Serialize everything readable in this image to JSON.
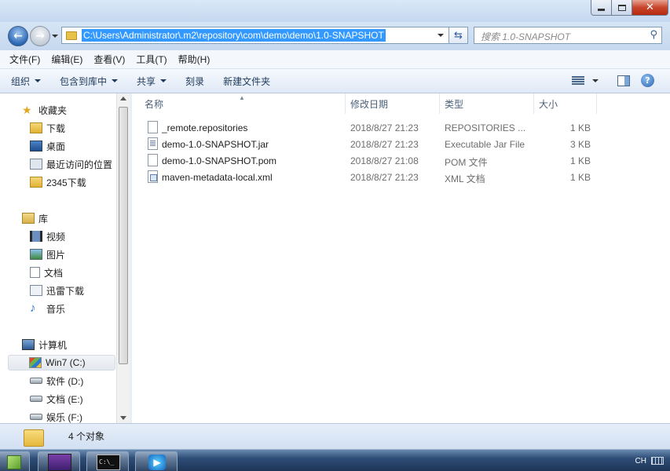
{
  "window": {
    "controls": {
      "minimize_icon": "minimize-icon",
      "maximize_icon": "maximize-icon",
      "close_icon": "close-icon"
    }
  },
  "address_bar": {
    "path": "C:\\Users\\Administrator\\.m2\\repository\\com\\demo\\demo\\1.0-SNAPSHOT",
    "refresh_icon": "refresh-icon"
  },
  "search": {
    "placeholder": "搜索 1.0-SNAPSHOT"
  },
  "menu": [
    "文件(F)",
    "编辑(E)",
    "查看(V)",
    "工具(T)",
    "帮助(H)"
  ],
  "toolbar": {
    "organize": "组织",
    "include_in_library": "包含到库中",
    "share": "共享",
    "burn": "刻录",
    "new_folder": "新建文件夹"
  },
  "nav": {
    "favorites": "收藏夹",
    "fav_items": [
      "下载",
      "桌面",
      "最近访问的位置",
      "2345下载"
    ],
    "libraries": "库",
    "lib_items": [
      "视频",
      "图片",
      "文档",
      "迅雷下载",
      "音乐"
    ],
    "computer": "计算机",
    "drives": [
      "Win7 (C:)",
      "软件 (D:)",
      "文档 (E:)",
      "娱乐 (F:)"
    ]
  },
  "columns": {
    "name": "名称",
    "modified": "修改日期",
    "type": "类型",
    "size": "大小"
  },
  "files": [
    {
      "name": "_remote.repositories",
      "modified": "2018/8/27 21:23",
      "type": "REPOSITORIES ...",
      "size": "1 KB",
      "icon": "file-icon"
    },
    {
      "name": "demo-1.0-SNAPSHOT.jar",
      "modified": "2018/8/27 21:23",
      "type": "Executable Jar File",
      "size": "3 KB",
      "icon": "jar-file-icon"
    },
    {
      "name": "demo-1.0-SNAPSHOT.pom",
      "modified": "2018/8/27 21:08",
      "type": "POM 文件",
      "size": "1 KB",
      "icon": "file-icon"
    },
    {
      "name": "maven-metadata-local.xml",
      "modified": "2018/8/27 21:23",
      "type": "XML 文档",
      "size": "1 KB",
      "icon": "xml-file-icon"
    }
  ],
  "status": {
    "count": "4 个对象"
  },
  "taskbar": {
    "apps": [
      "notepad-plus-plus-icon",
      "eclipse-java-ee-icon",
      "command-prompt-icon",
      "media-player-icon"
    ],
    "input_method": "CH"
  },
  "colors": {
    "selection": "#3399ff",
    "chrome": "#c8dcf0",
    "close": "#c8452c"
  }
}
